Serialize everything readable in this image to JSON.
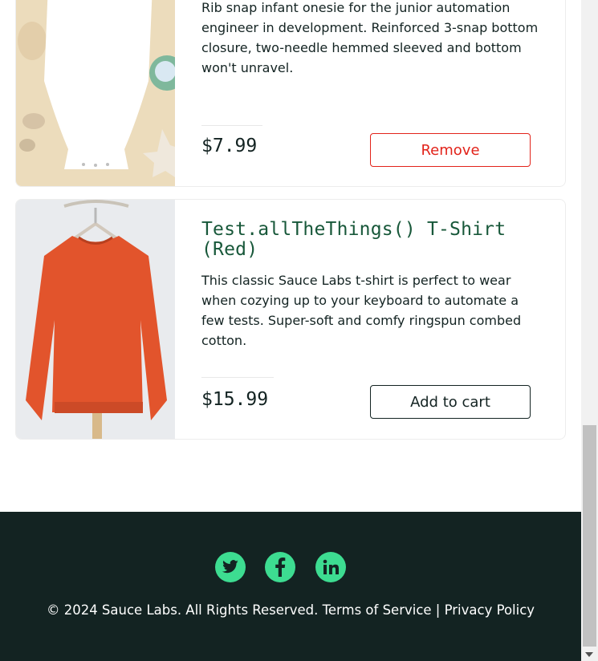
{
  "items": [
    {
      "name": "",
      "description": "Rib snap infant onesie for the junior automation engineer in development. Reinforced 3-snap bottom closure, two-needle hemmed sleeved and bottom won't unravel.",
      "price": "$7.99",
      "button_label": "Remove",
      "image_icon": "onesie-image"
    },
    {
      "name": "Test.allTheThings() T-Shirt (Red)",
      "description": "This classic Sauce Labs t-shirt is perfect to wear when cozying up to your keyboard to automate a few tests. Super-soft and comfy ringspun combed cotton.",
      "price": "$15.99",
      "button_label": "Add to cart",
      "image_icon": "red-sweatshirt-image"
    }
  ],
  "footer": {
    "social": [
      "twitter-icon",
      "facebook-icon",
      "linkedin-icon"
    ],
    "copyright": "© 2024 Sauce Labs. All Rights Reserved. Terms of Service | Privacy Policy"
  },
  "colors": {
    "accent": "#3ddc91",
    "footer_bg": "#132322",
    "item_name": "#18583a",
    "remove": "#e2231a"
  }
}
